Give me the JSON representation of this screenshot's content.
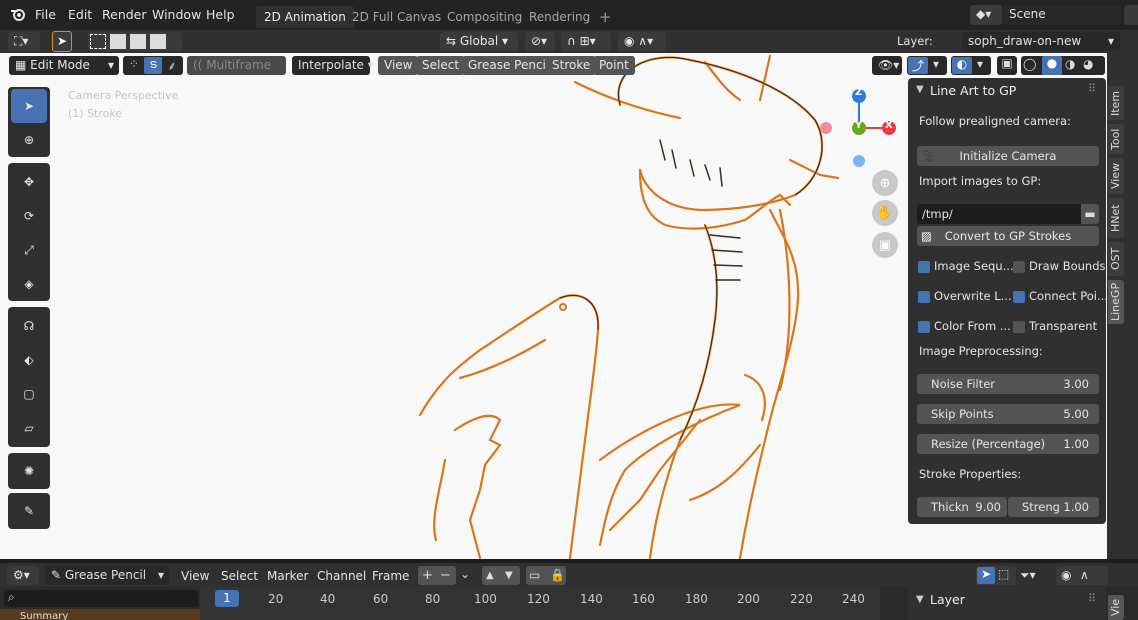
{
  "topbar": {
    "menu": [
      "File",
      "Edit",
      "Render",
      "Window",
      "Help"
    ],
    "workspace_tabs": [
      "2D Animation",
      "2D Full Canvas",
      "Compositing",
      "Rendering"
    ],
    "add_tab": "+",
    "scene_label": "Scene"
  },
  "header": {
    "orientation": "Global",
    "layer_label": "Layer:",
    "layer_value": "soph_draw-on-new"
  },
  "viewport_header": {
    "mode": "Edit Mode",
    "multiframe": "Multiframe",
    "interpolate": "Interpolate",
    "menus": [
      "View",
      "Select",
      "Grease Pencil",
      "Stroke",
      "Point"
    ]
  },
  "viewport": {
    "overlay_line1": "Camera Perspective",
    "overlay_line2": "(1) Stroke",
    "gizmo": {
      "z": "Z",
      "y": "Y",
      "x": "X"
    }
  },
  "npanel": {
    "title": "Line Art to GP",
    "follow_label": "Follow prealigned camera:",
    "init_camera": "Initialize Camera",
    "import_label": "Import images to GP:",
    "path": "/tmp/",
    "convert": "Convert to GP Strokes",
    "checks": [
      {
        "label": "Image Sequ...",
        "checked": true
      },
      {
        "label": "Draw Bounds",
        "checked": false
      },
      {
        "label": "Overwrite L...",
        "checked": true
      },
      {
        "label": "Connect Poi...",
        "checked": true
      },
      {
        "label": "Color From ...",
        "checked": true
      },
      {
        "label": "Transparent",
        "checked": false
      }
    ],
    "preproc_label": "Image Preprocessing:",
    "fields": [
      {
        "label": "Noise Filter",
        "value": "3.00"
      },
      {
        "label": "Skip Points",
        "value": "5.00"
      },
      {
        "label": "Resize (Percentage)",
        "value": "1.00"
      }
    ],
    "stroke_props_label": "Stroke Properties:",
    "thick_label": "Thickn",
    "thick_value": "9.00",
    "strength_label": "Streng",
    "strength_value": "1.00"
  },
  "side_tabs": [
    "Item",
    "Tool",
    "View",
    "HNet",
    "OST",
    "LineGP"
  ],
  "timeline": {
    "editor": "Grease Pencil",
    "menus": [
      "View",
      "Select",
      "Marker",
      "Channel",
      "Frame"
    ],
    "current_frame": "1",
    "ticks": [
      "20",
      "40",
      "60",
      "80",
      "100",
      "120",
      "140",
      "160",
      "180",
      "200",
      "220",
      "240"
    ],
    "layer_panel": "Layer",
    "bottom_tab": "Vie",
    "summary": "Summary"
  },
  "colors": {
    "accent": "#4772b3",
    "stroke": "#e07a1a",
    "bg": "#303030"
  }
}
